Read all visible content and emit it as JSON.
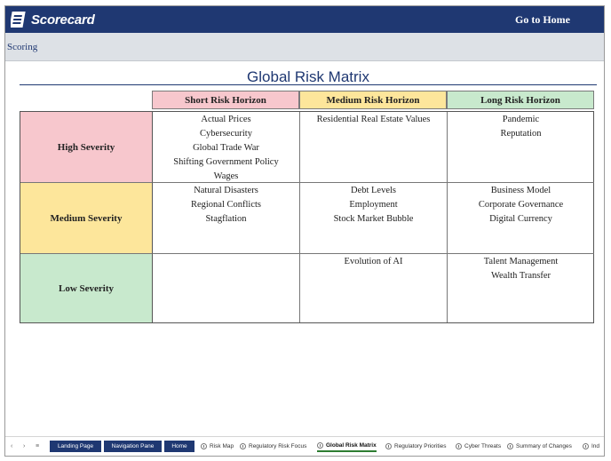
{
  "header": {
    "logo_text": "Scorecard",
    "go_home_label": "Go to Home"
  },
  "subheader": {
    "label": "Scoring"
  },
  "matrix": {
    "title": "Global Risk Matrix",
    "columns": [
      "Short Risk Horizon",
      "Medium Risk Horizon",
      "Long Risk Horizon"
    ],
    "rows": [
      {
        "label": "High Severity",
        "cells": [
          [
            "Actual Prices",
            "Cybersecurity",
            "Global Trade War",
            "Shifting Government Policy",
            "Wages"
          ],
          [
            "Residential Real Estate Values"
          ],
          [
            "Pandemic",
            "Reputation"
          ]
        ]
      },
      {
        "label": "Medium Severity",
        "cells": [
          [
            "Natural Disasters",
            "Regional Conflicts",
            "Stagflation"
          ],
          [
            "Debt Levels",
            "Employment",
            "Stock Market Bubble"
          ],
          [
            "Business Model",
            "Corporate Governance",
            "Digital Currency"
          ]
        ]
      },
      {
        "label": "Low Severity",
        "cells": [
          [],
          [
            "Evolution of AI"
          ],
          [
            "Talent Management",
            "Wealth Transfer"
          ]
        ]
      }
    ],
    "colors": {
      "high": "#f7c7cd",
      "medium": "#fde69b",
      "low": "#c8e9cd",
      "brand": "#1f3872"
    }
  },
  "tabbar": {
    "nav_prev": "‹",
    "nav_next": "›",
    "nav_all": "≡",
    "tabs": [
      {
        "label": "Landing Page",
        "style": "dark"
      },
      {
        "label": "Navigation Pane",
        "style": "dark"
      },
      {
        "label": "Home",
        "style": "dark"
      },
      {
        "label": "Risk Map",
        "style": "plain"
      },
      {
        "label": "Regulatory Risk Focus",
        "style": "plain"
      },
      {
        "label": "Global Risk Matrix",
        "style": "active"
      },
      {
        "label": "Regulatory Priorities",
        "style": "plain"
      },
      {
        "label": "Cyber Threats",
        "style": "plain"
      },
      {
        "label": "Summary of Changes",
        "style": "plain"
      },
      {
        "label": "Ind",
        "style": "plain"
      }
    ]
  }
}
